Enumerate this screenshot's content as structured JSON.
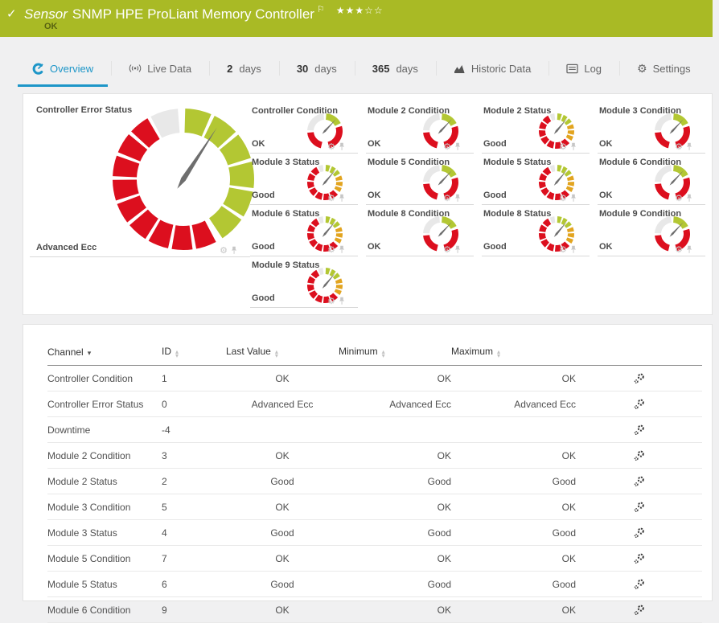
{
  "header": {
    "kind": "Sensor",
    "title": "SNMP HPE ProLiant Memory Controller",
    "status": "OK",
    "stars_filled": 3,
    "stars_total": 5,
    "accent_color": "#a9ba25"
  },
  "tabs": [
    {
      "label": "Overview",
      "active": true
    },
    {
      "label": "Live Data"
    },
    {
      "num": "2",
      "label": "days"
    },
    {
      "num": "30",
      "label": "days"
    },
    {
      "num": "365",
      "label": "days"
    },
    {
      "label": "Historic Data"
    },
    {
      "label": "Log"
    },
    {
      "label": "Settings"
    }
  ],
  "colors": {
    "ok_green": "#b3c733",
    "error_red": "#dc0f1e",
    "warning_yellow": "#e2a41f",
    "inactive_gray": "#e8e8e8",
    "needle": "#6e6e6e",
    "tab_active_blue": "#1d96c8"
  },
  "gauge_types": {
    "big": {
      "size": 178,
      "thickness": 30,
      "gap": 3,
      "needle_angle": 33,
      "needle_len": 0.87,
      "needle_w": 3.2,
      "needle_tail": 14,
      "segments": [
        {
          "color": "inactive_gray",
          "from": -29,
          "to": -3,
          "count": 1
        },
        {
          "color": "ok_green",
          "from": 0,
          "to": 148,
          "count": 6
        },
        {
          "color": "error_red",
          "from": 151,
          "to": 331,
          "count": 9
        }
      ]
    },
    "condition": {
      "size": 46,
      "thickness": 8,
      "gap": 5,
      "needle_angle": 43,
      "needle_len": 0.92,
      "needle_w": 1.3,
      "needle_tail": 5,
      "segments": [
        {
          "color": "inactive_gray",
          "from": -90,
          "to": -2,
          "count": 1
        },
        {
          "color": "ok_green",
          "from": 2,
          "to": 66,
          "count": 1
        },
        {
          "color": "error_red",
          "from": 71,
          "to": 168,
          "count": 1
        },
        {
          "color": "error_red",
          "from": 191,
          "to": 267,
          "count": 1
        }
      ]
    },
    "status": {
      "size": 46,
      "thickness": 8,
      "gap": 6,
      "needle_angle": 40,
      "needle_len": 0.92,
      "needle_w": 1.3,
      "needle_tail": 5,
      "segments": [
        {
          "color": "inactive_gray",
          "from": -26,
          "to": -4,
          "count": 1
        },
        {
          "color": "ok_green",
          "from": 0,
          "to": 62,
          "count": 3
        },
        {
          "color": "warning_yellow",
          "from": 64,
          "to": 126,
          "count": 3
        },
        {
          "color": "error_red",
          "from": 130,
          "to": 334,
          "count": 7
        }
      ]
    }
  },
  "overview": {
    "big_gauge": {
      "title": "Controller Error Status",
      "value": "Advanced Ecc",
      "type": "big"
    },
    "gauges": [
      {
        "title": "Controller Condition",
        "value": "OK",
        "type": "condition"
      },
      {
        "title": "Module 2 Condition",
        "value": "OK",
        "type": "condition"
      },
      {
        "title": "Module 2 Status",
        "value": "Good",
        "type": "status"
      },
      {
        "title": "Module 3 Condition",
        "value": "OK",
        "type": "condition"
      },
      {
        "title": "Module 3 Status",
        "value": "Good",
        "type": "status"
      },
      {
        "title": "Module 5 Condition",
        "value": "OK",
        "type": "condition"
      },
      {
        "title": "Module 5 Status",
        "value": "Good",
        "type": "status"
      },
      {
        "title": "Module 6 Condition",
        "value": "OK",
        "type": "condition"
      },
      {
        "title": "Module 6 Status",
        "value": "Good",
        "type": "status"
      },
      {
        "title": "Module 8 Condition",
        "value": "OK",
        "type": "condition"
      },
      {
        "title": "Module 8 Status",
        "value": "Good",
        "type": "status"
      },
      {
        "title": "Module 9 Condition",
        "value": "OK",
        "type": "condition"
      },
      {
        "title": "Module 9 Status",
        "value": "Good",
        "type": "status"
      }
    ]
  },
  "table": {
    "columns": [
      {
        "label": "Channel",
        "sorted": "desc"
      },
      {
        "label": "ID"
      },
      {
        "label": "Last Value"
      },
      {
        "label": "Minimum"
      },
      {
        "label": "Maximum"
      }
    ],
    "rows": [
      [
        "Controller Condition",
        "1",
        "OK",
        "OK",
        "OK"
      ],
      [
        "Controller Error Status",
        "0",
        "Advanced Ecc",
        "Advanced Ecc",
        "Advanced Ecc"
      ],
      [
        "Downtime",
        "-4",
        "",
        "",
        ""
      ],
      [
        "Module 2 Condition",
        "3",
        "OK",
        "OK",
        "OK"
      ],
      [
        "Module 2 Status",
        "2",
        "Good",
        "Good",
        "Good"
      ],
      [
        "Module 3 Condition",
        "5",
        "OK",
        "OK",
        "OK"
      ],
      [
        "Module 3 Status",
        "4",
        "Good",
        "Good",
        "Good"
      ],
      [
        "Module 5 Condition",
        "7",
        "OK",
        "OK",
        "OK"
      ],
      [
        "Module 5 Status",
        "6",
        "Good",
        "Good",
        "Good"
      ],
      [
        "Module 6 Condition",
        "9",
        "OK",
        "OK",
        "OK"
      ]
    ]
  }
}
